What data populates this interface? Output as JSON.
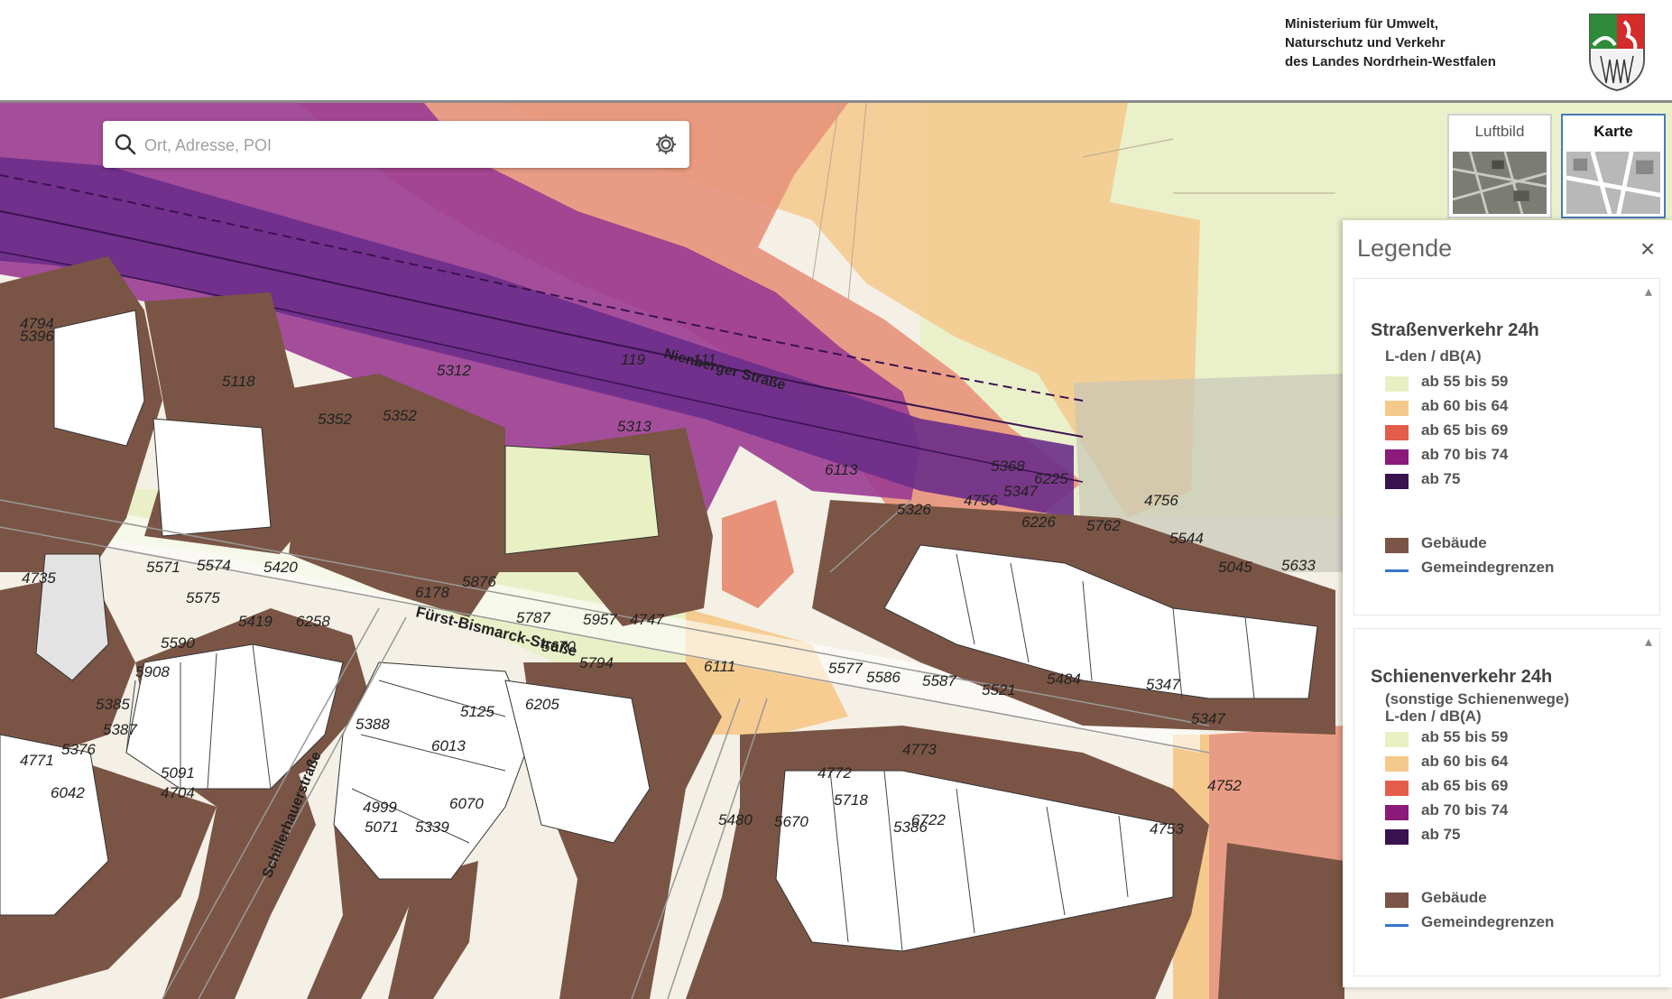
{
  "header": {
    "ministry_line1": "Ministerium für Umwelt,",
    "ministry_line2": "Naturschutz und Verkehr",
    "ministry_line3": "des Landes Nordrhein-Westfalen",
    "crest_icon": "nrw-coat-of-arms-icon"
  },
  "search": {
    "placeholder": "Ort, Adresse, POI"
  },
  "basemaps": {
    "luftbild_label": "Luftbild",
    "karte_label": "Karte",
    "active": "Karte"
  },
  "legend": {
    "title": "Legende",
    "close_icon": "×",
    "sections": [
      {
        "title": "Straßenverkehr 24h",
        "subtitle": "L-den / dB(A)",
        "classes": [
          {
            "label": "ab 55 bis 59",
            "color": "#e8f0c4"
          },
          {
            "label": "ab 60 bis 64",
            "color": "#f5c98c"
          },
          {
            "label": "ab 65 bis 69",
            "color": "#e35d4a"
          },
          {
            "label": "ab 70 bis 74",
            "color": "#8b1a7a"
          },
          {
            "label": "ab 75",
            "color": "#3a1250"
          }
        ],
        "extra": [
          {
            "label": "Gebäude",
            "color": "#7a5545",
            "kind": "fill"
          },
          {
            "label": "Gemeindegrenzen",
            "color": "#3a74c9",
            "kind": "line"
          }
        ]
      },
      {
        "title": "Schienenverkehr 24h",
        "subtitle": "(sonstige Schienenwege)",
        "subtitle2": "L-den / dB(A)",
        "classes": [
          {
            "label": "ab 55 bis 59",
            "color": "#e8f0c4"
          },
          {
            "label": "ab 60 bis 64",
            "color": "#f5c98c"
          },
          {
            "label": "ab 65 bis 69",
            "color": "#e35d4a"
          },
          {
            "label": "ab 70 bis 74",
            "color": "#8b1a7a"
          },
          {
            "label": "ab 75",
            "color": "#3a1250"
          }
        ],
        "extra": [
          {
            "label": "Gebäude",
            "color": "#7a5545",
            "kind": "fill"
          },
          {
            "label": "Gemeindegrenzen",
            "color": "#3a74c9",
            "kind": "line"
          }
        ]
      }
    ]
  },
  "map": {
    "street_labels": [
      "Fürst-Bismarck-Straße",
      "Nienberger Straße",
      "Schillerhauerstraße"
    ],
    "parcel_labels": [
      "4794",
      "5118",
      "5352",
      "5312",
      "5352",
      "5313",
      "6111",
      "6113",
      "5368",
      "6225",
      "5347",
      "4756",
      "4756",
      "5326",
      "6226",
      "5762",
      "5544",
      "5045",
      "5633",
      "4735",
      "5571",
      "5574",
      "5420",
      "5876",
      "6178",
      "5575",
      "5419",
      "6258",
      "5787",
      "5957",
      "4747",
      "5590",
      "5670",
      "5908",
      "5794",
      "5385",
      "6205",
      "5388",
      "5125",
      "6013",
      "5387",
      "5376",
      "4771",
      "5091",
      "6042",
      "4704",
      "4999",
      "6070",
      "5071",
      "5339",
      "5577",
      "5586",
      "5587",
      "5521",
      "5484",
      "5347",
      "5347",
      "4773",
      "4752",
      "5718",
      "6722",
      "4753",
      "5480",
      "5670",
      "4772",
      "111",
      "119",
      "5386",
      "5396"
    ]
  }
}
